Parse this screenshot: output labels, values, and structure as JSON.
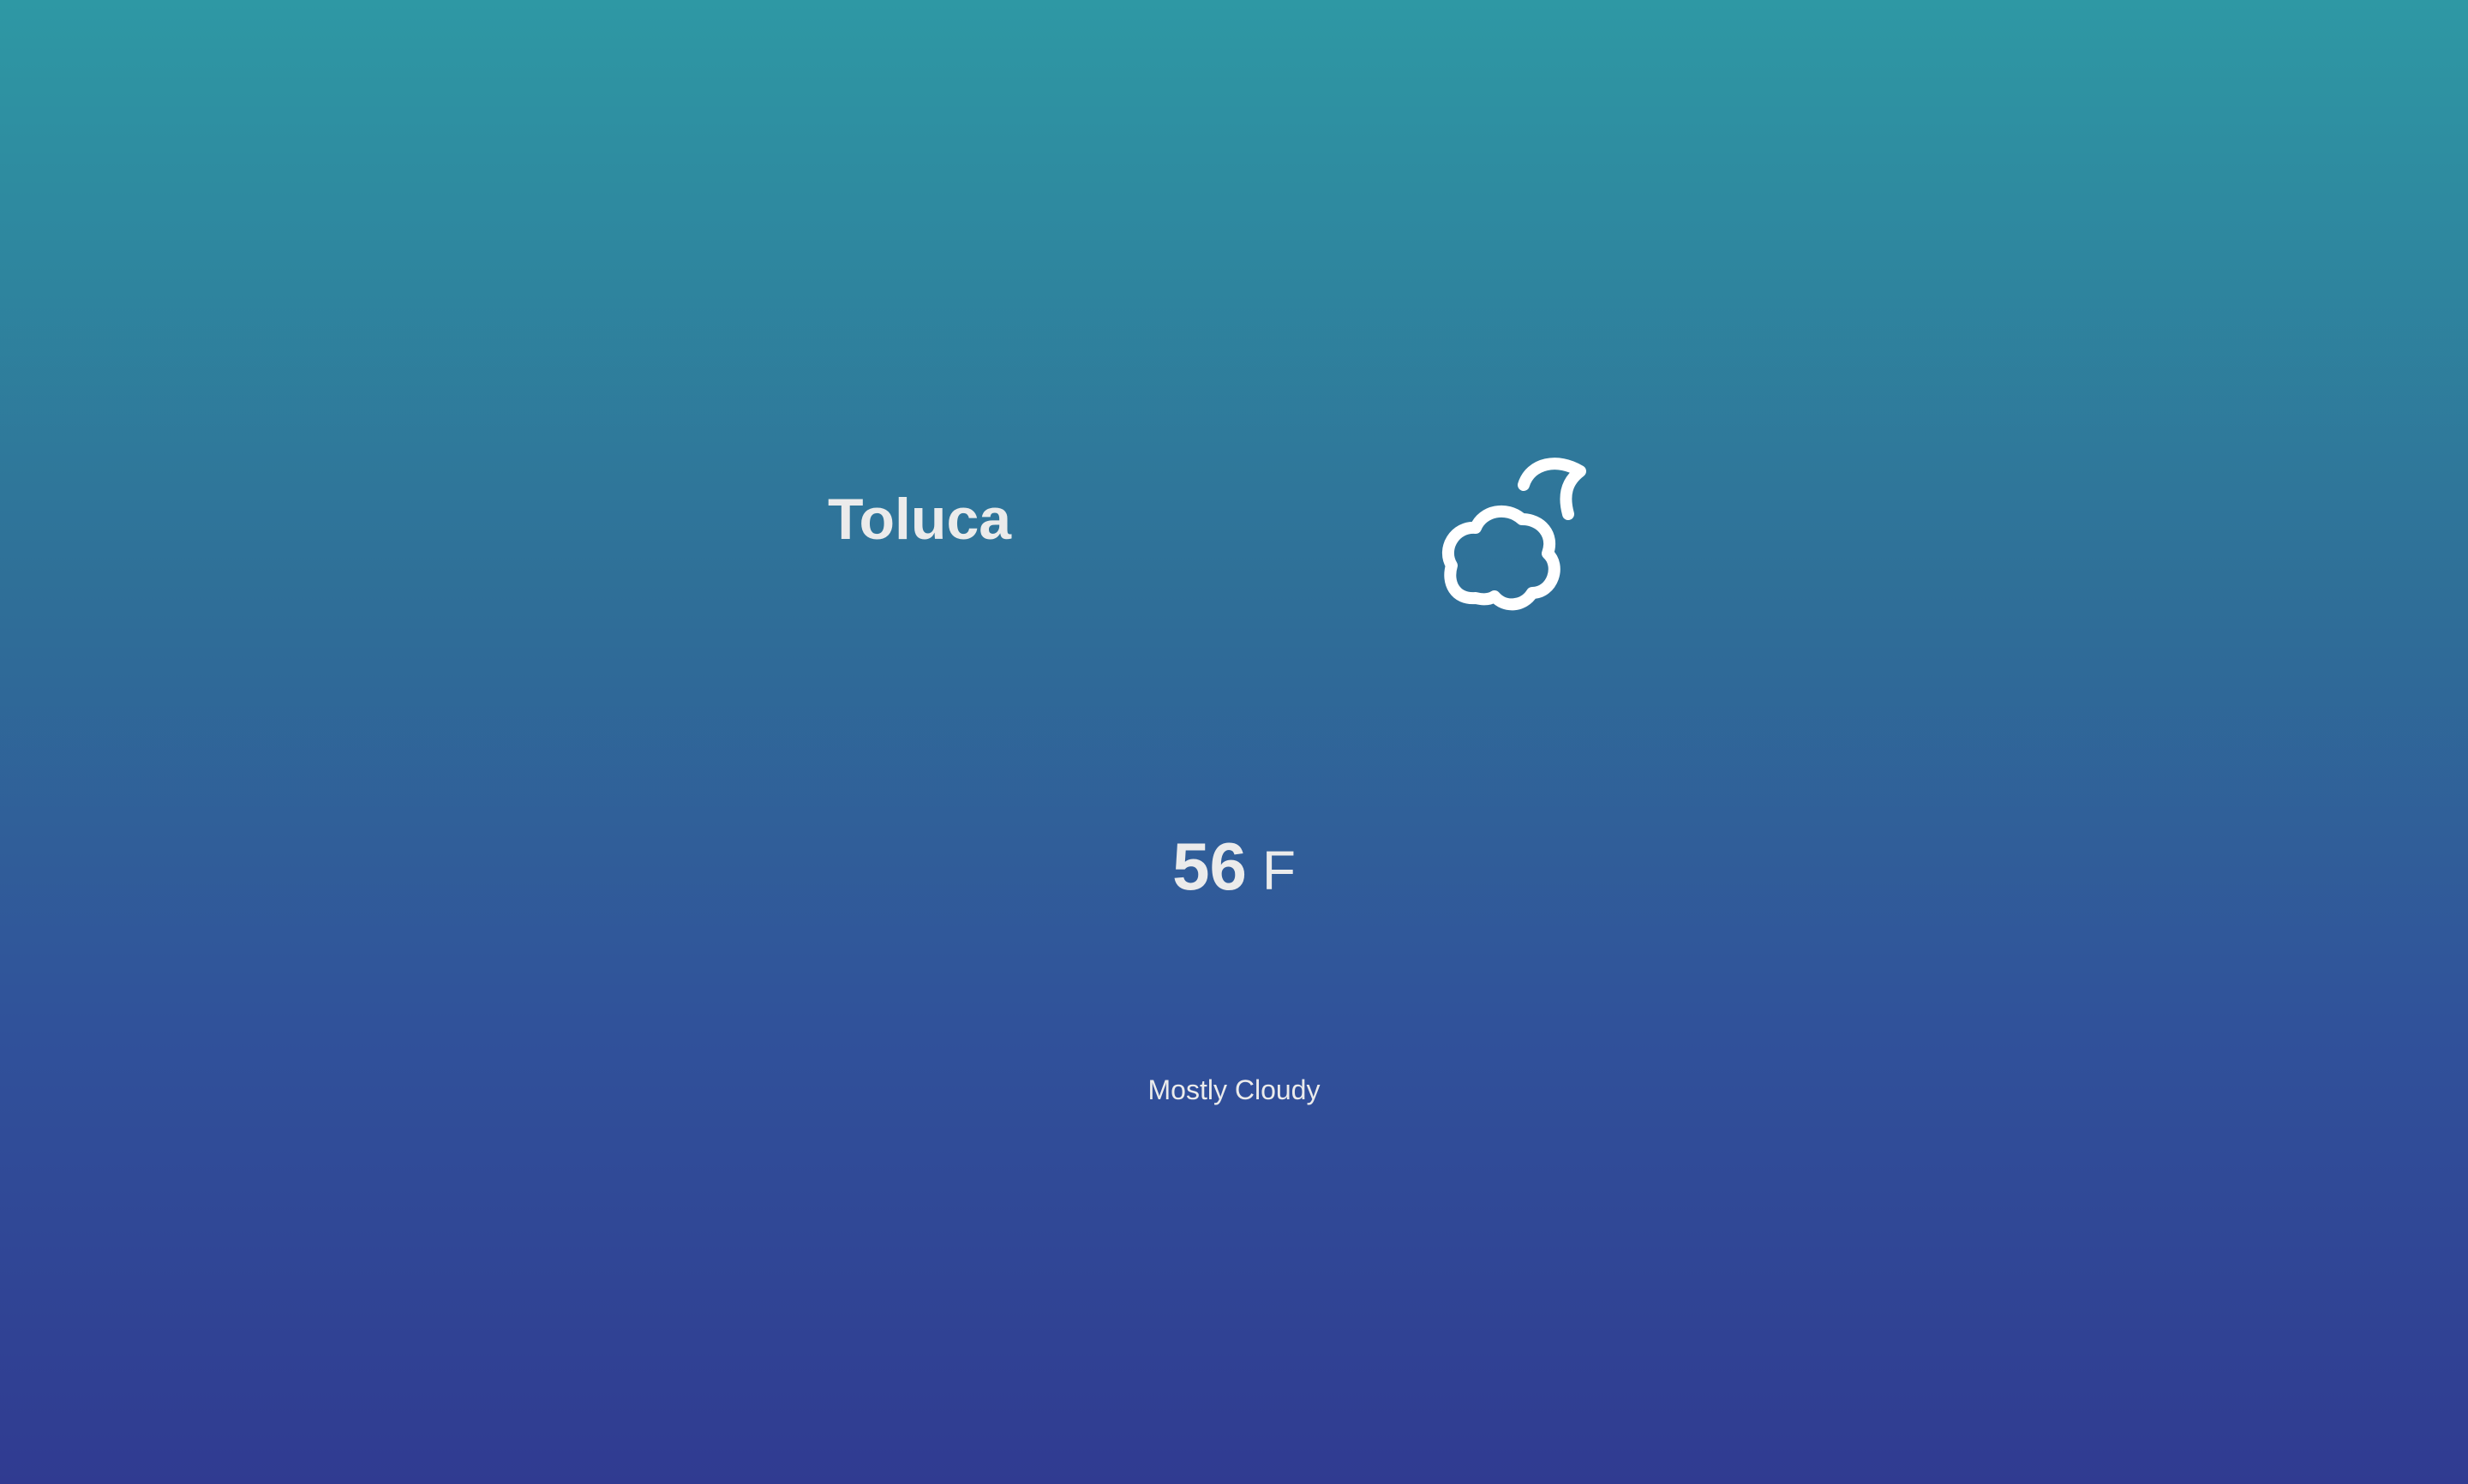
{
  "location": {
    "city": "Toluca"
  },
  "current": {
    "temperature": "56",
    "unit": "F",
    "condition": "Mostly Cloudy",
    "icon": "cloud-moon-icon"
  },
  "colors": {
    "background_top": "#2e98a4",
    "background_bottom": "#303b91",
    "text": "#ebebeb"
  }
}
